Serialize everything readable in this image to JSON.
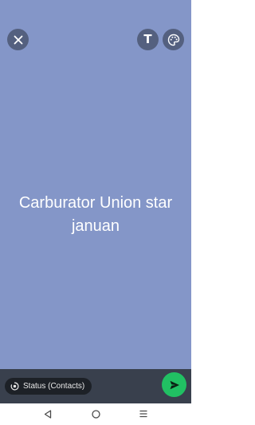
{
  "status": {
    "text": "Carburator Union star januan",
    "background_color": "#8496c8"
  },
  "top_bar": {
    "close_icon": "close-icon",
    "text_tool_label": "T",
    "palette_icon": "palette-icon"
  },
  "bottom_bar": {
    "audience_label": "Status (Contacts)",
    "audience_icon": "status-icon",
    "send_icon": "send-icon",
    "send_color": "#21c063"
  },
  "nav": {
    "back_icon": "back-triangle-icon",
    "home_icon": "home-circle-icon",
    "recents_icon": "recents-lines-icon"
  }
}
